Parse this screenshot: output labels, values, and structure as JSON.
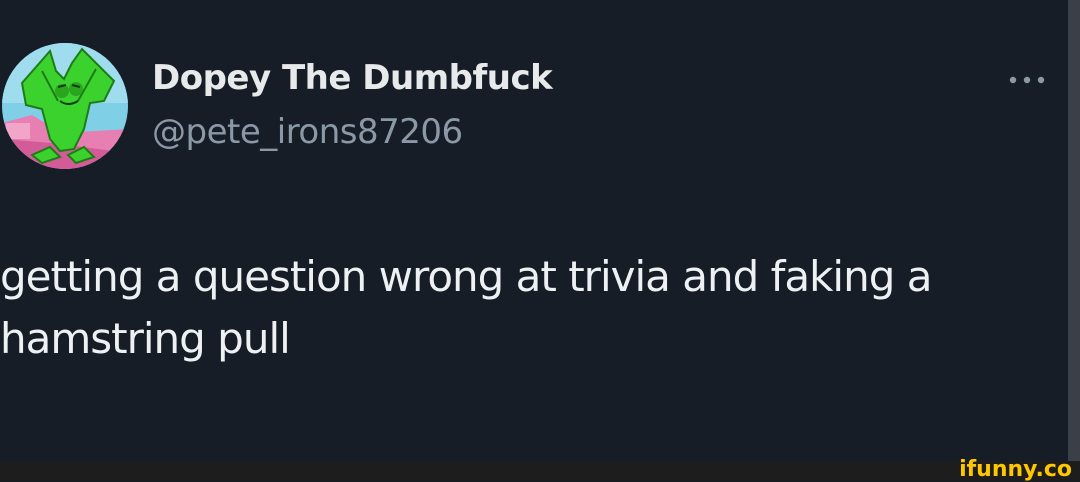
{
  "tweet": {
    "display_name": "Dopey The Dumbfuck",
    "handle": "@pete_irons87206",
    "text": "getting a question wrong at trivia and faking a hamstring pull",
    "more_icon": "ellipsis-icon"
  },
  "watermark": {
    "text": "ifunny.co"
  },
  "colors": {
    "background": "#161d27",
    "name": "#e7e9ea",
    "handle": "#8b98a5",
    "watermark": "#ffc700"
  }
}
